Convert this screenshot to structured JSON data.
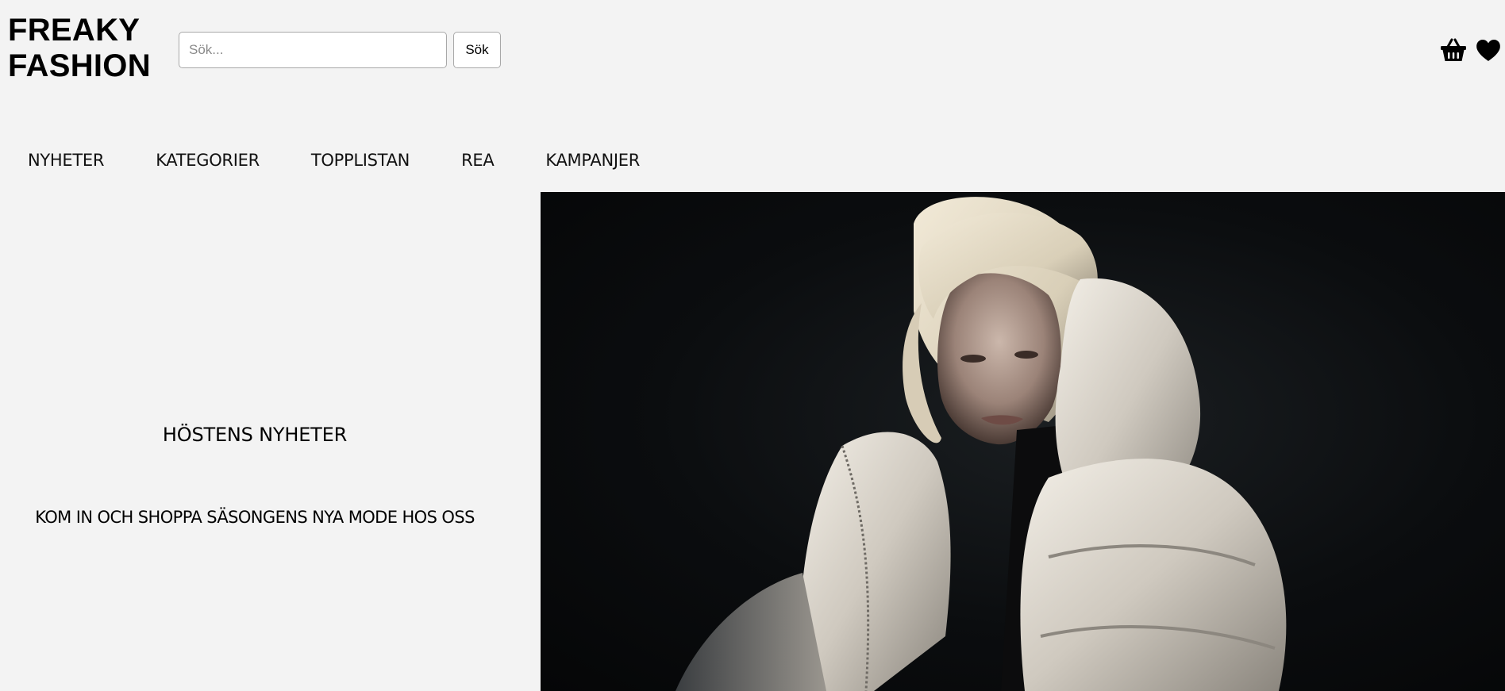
{
  "header": {
    "logo_line1": "FREAKY",
    "logo_line2": "FASHION",
    "search": {
      "placeholder": "Sök...",
      "value": "",
      "button_label": "Sök"
    },
    "icons": [
      "basket-icon",
      "heart-icon"
    ]
  },
  "nav": {
    "items": [
      {
        "label": "NYHETER"
      },
      {
        "label": "KATEGORIER"
      },
      {
        "label": "TOPPLISTAN"
      },
      {
        "label": "REA"
      },
      {
        "label": "KAMPANJER"
      }
    ]
  },
  "hero": {
    "title": "HÖSTENS NYHETER",
    "subtitle": "KOM IN OCH SHOPPA SÄSONGENS NYA MODE HOS OSS"
  },
  "colors": {
    "page_background": "#f3f3f3",
    "text": "#000000",
    "hero_background": "#0b0d0f",
    "jacket": "#e6e2da"
  }
}
